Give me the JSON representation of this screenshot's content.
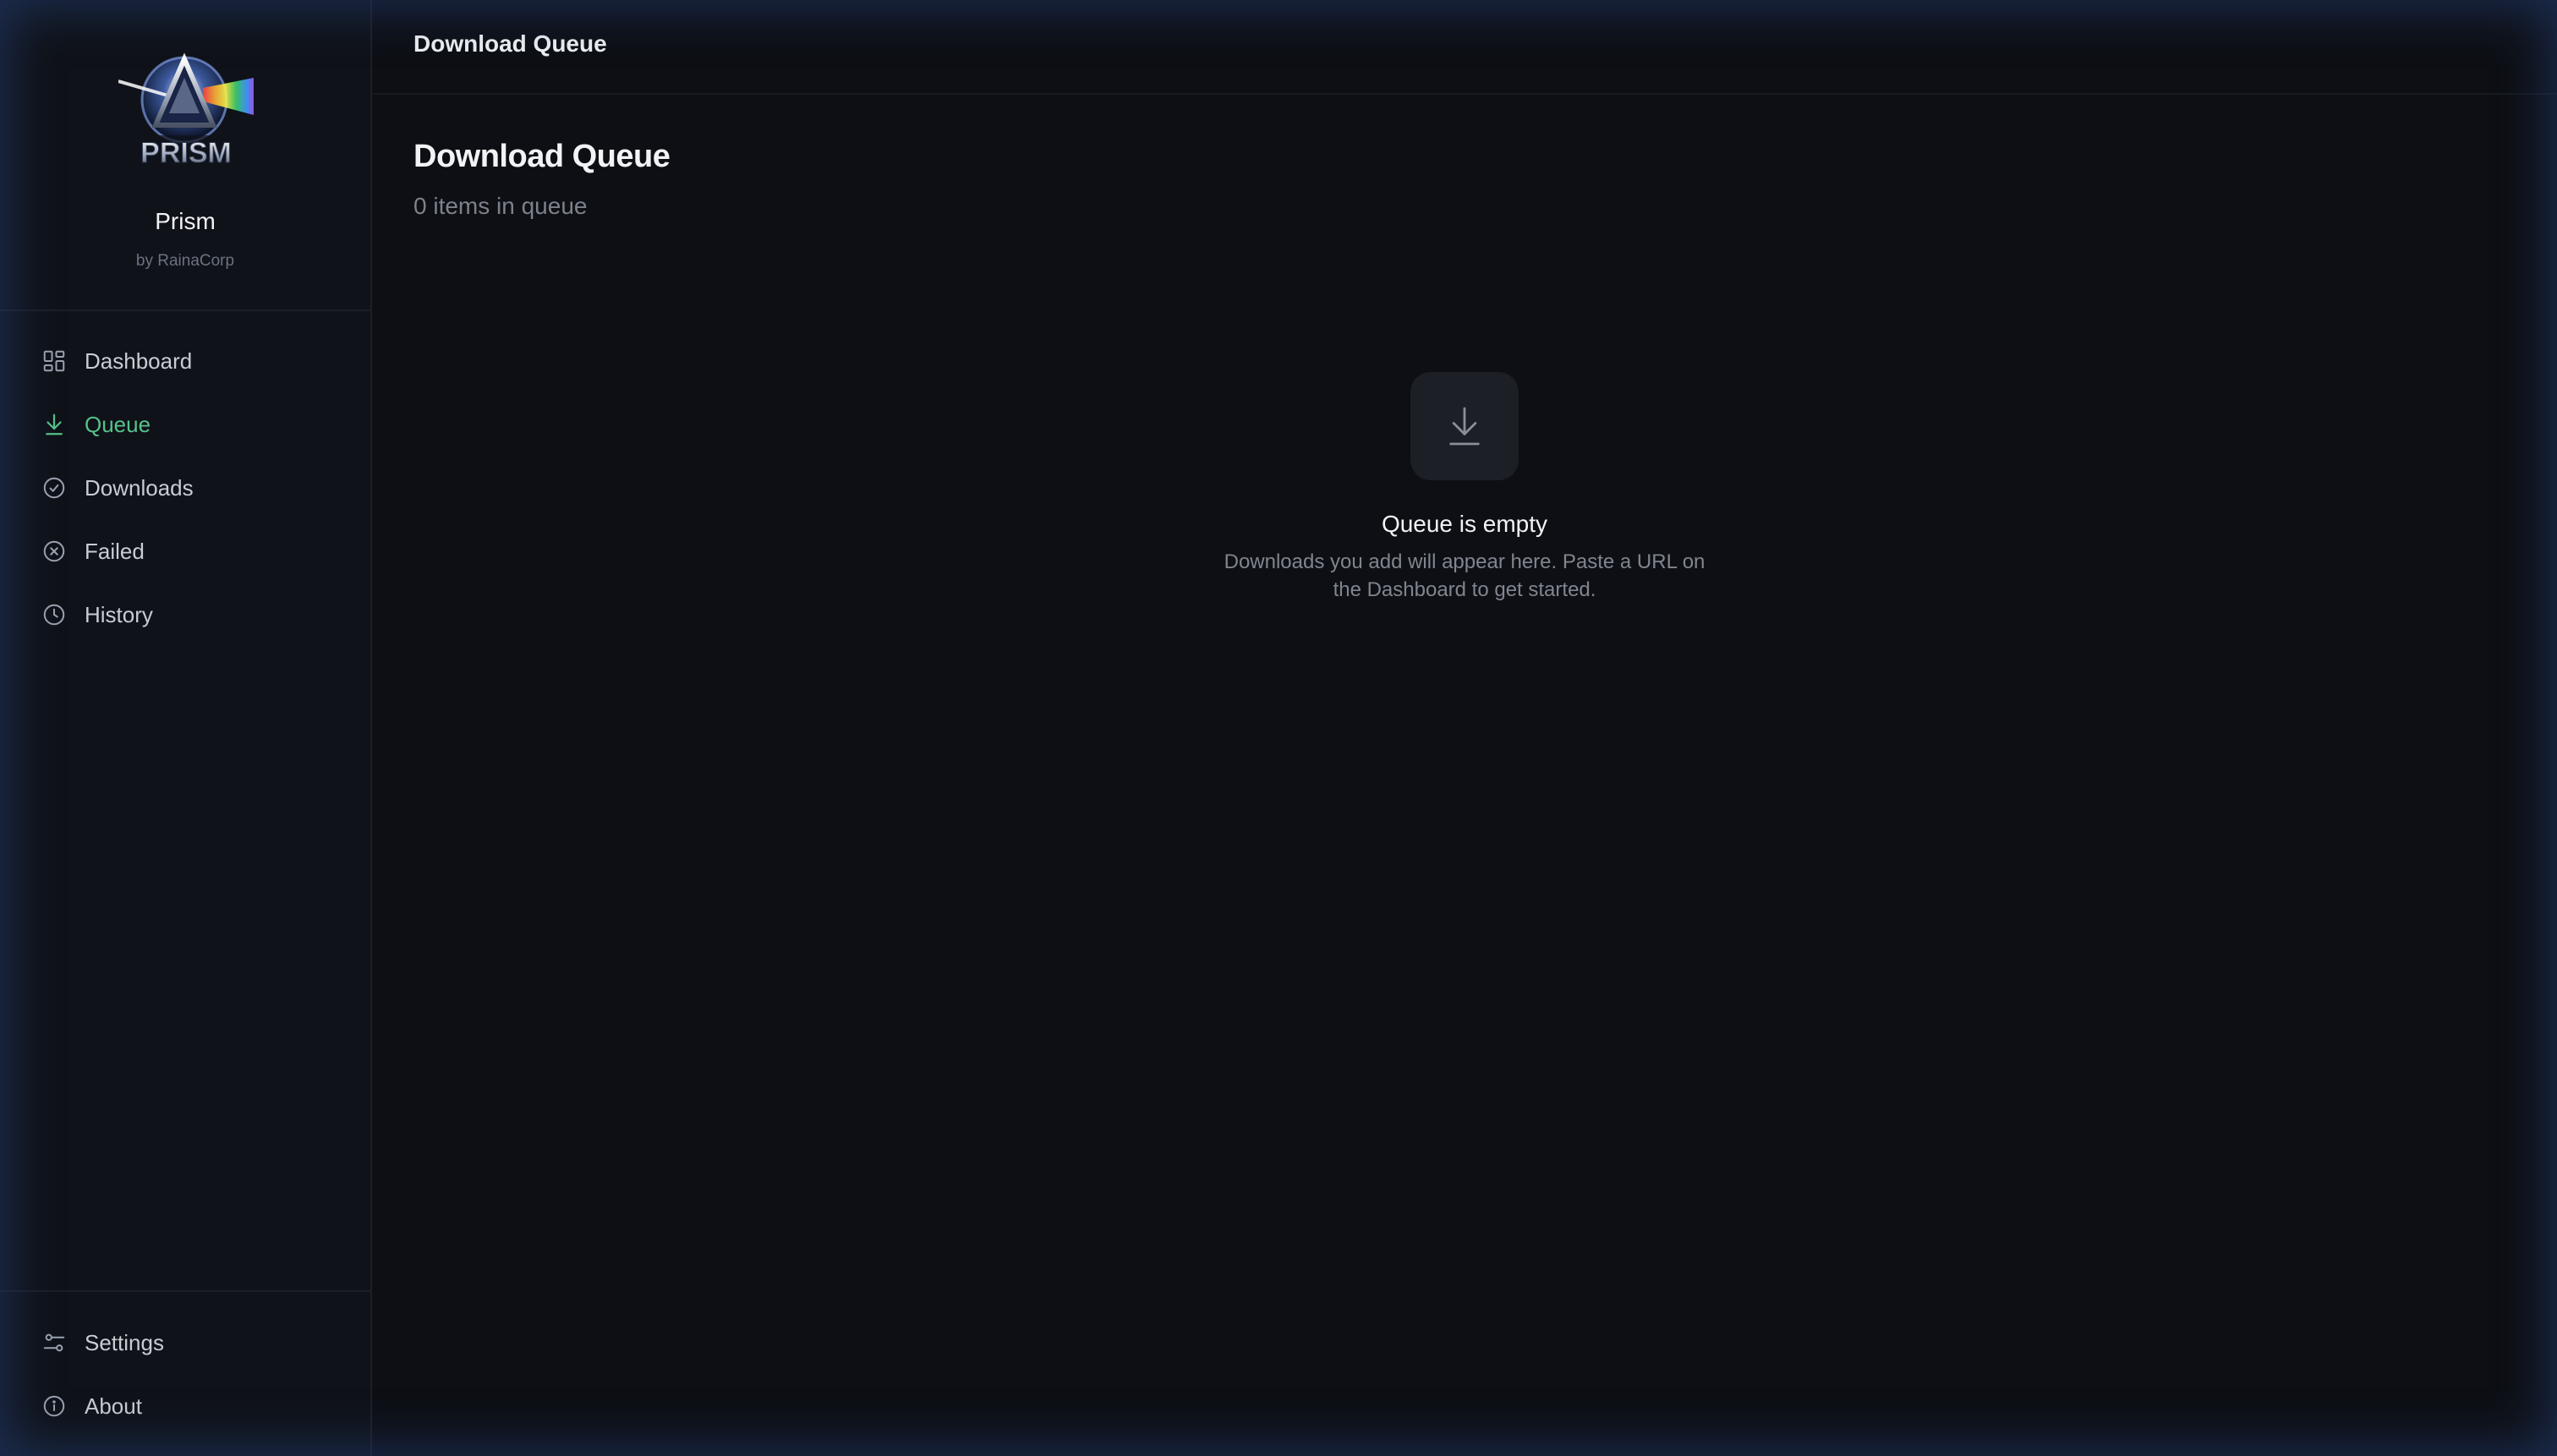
{
  "app": {
    "name": "Prism",
    "byline": "by RainaCorp",
    "logo_text": "PRISM"
  },
  "sidebar": {
    "items": [
      {
        "label": "Dashboard",
        "icon": "dashboard-grid-icon",
        "active": false
      },
      {
        "label": "Queue",
        "icon": "download-icon",
        "active": true
      },
      {
        "label": "Downloads",
        "icon": "check-circle-icon",
        "active": false
      },
      {
        "label": "Failed",
        "icon": "x-circle-icon",
        "active": false
      },
      {
        "label": "History",
        "icon": "clock-icon",
        "active": false
      }
    ],
    "bottom_items": [
      {
        "label": "Settings",
        "icon": "sliders-icon"
      },
      {
        "label": "About",
        "icon": "info-circle-icon"
      }
    ]
  },
  "topbar": {
    "title": "Download Queue"
  },
  "main": {
    "title": "Download Queue",
    "subtitle": "0 items in queue",
    "empty_state": {
      "icon": "download-icon",
      "title": "Queue is empty",
      "text": "Downloads you add will appear here. Paste a URL on the Dashboard to get started."
    }
  },
  "colors": {
    "accent": "#56c28a",
    "background": "#0d0f14",
    "sidebar": "#0f1218"
  }
}
